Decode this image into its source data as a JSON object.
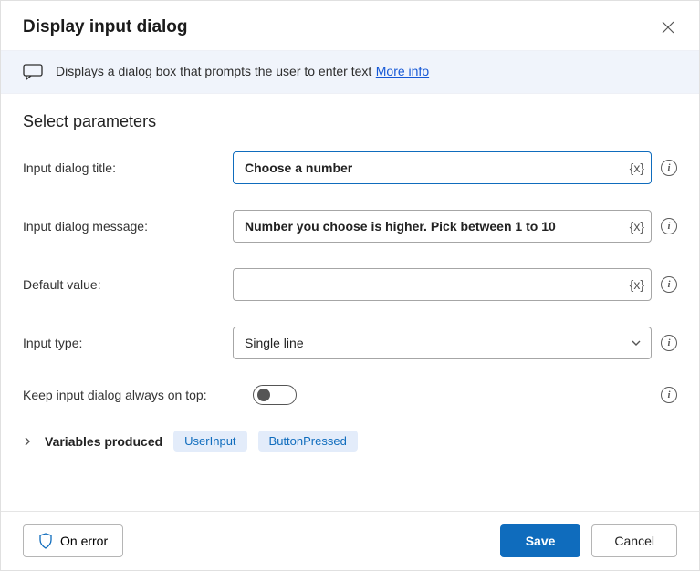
{
  "header": {
    "title": "Display input dialog"
  },
  "infobar": {
    "description": "Displays a dialog box that prompts the user to enter text",
    "more_info": "More info"
  },
  "section": {
    "title": "Select parameters"
  },
  "fields": {
    "title_label": "Input dialog title:",
    "title_value": "Choose a number",
    "message_label": "Input dialog message:",
    "message_value": "Number you choose is higher. Pick between 1 to 10",
    "default_label": "Default value:",
    "default_value": "",
    "type_label": "Input type:",
    "type_value": "Single line",
    "ontop_label": "Keep input dialog always on top:",
    "ontop_value": false,
    "var_token": "{x}"
  },
  "variables_produced": {
    "label": "Variables produced",
    "items": [
      "UserInput",
      "ButtonPressed"
    ]
  },
  "footer": {
    "on_error": "On error",
    "save": "Save",
    "cancel": "Cancel"
  }
}
